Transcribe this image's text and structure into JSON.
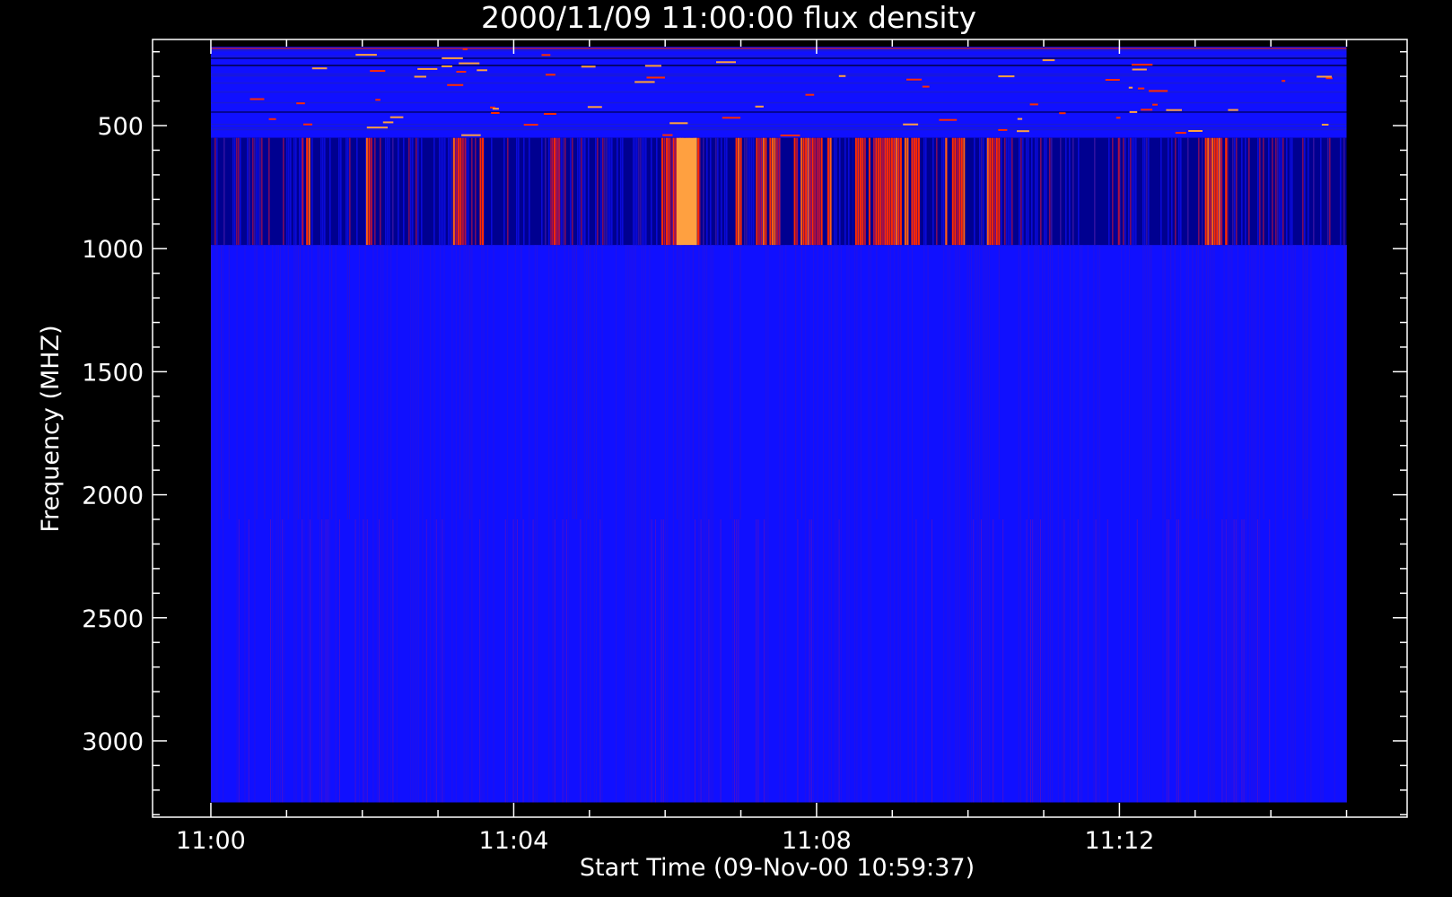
{
  "chart_data": {
    "type": "heatmap",
    "title": "2000/11/09 11:00:00 flux density",
    "xlabel": "Start Time (09-Nov-00 10:59:37)",
    "ylabel": "Frequency (MHZ)",
    "x_axis": {
      "ticks": [
        {
          "value": "11:00",
          "minutes": 0
        },
        {
          "value": "11:04",
          "minutes": 4
        },
        {
          "value": "11:08",
          "minutes": 8
        },
        {
          "value": "11:12",
          "minutes": 12
        }
      ],
      "minor_step_minutes": 1,
      "range_minutes": [
        -0.77,
        15.8
      ]
    },
    "y_axis": {
      "ticks": [
        500,
        1000,
        1500,
        2000,
        2500,
        3000
      ],
      "minor_step": 100,
      "range": [
        150,
        3310
      ],
      "inverted": true
    },
    "data_extent": {
      "time_minutes": [
        0,
        15
      ],
      "frequency": [
        180,
        3250
      ]
    },
    "bands": [
      {
        "frequency": [
          180,
          550
        ],
        "level": "low, noisy with sparse narrow spikes"
      },
      {
        "frequency": [
          550,
          985
        ],
        "level": "bursts (dark blue background with red/orange vertical bursts)"
      },
      {
        "frequency": [
          985,
          3250
        ],
        "level": "low (blue)"
      }
    ],
    "bursts_minutes": [
      [
        1.2,
        1.3
      ],
      [
        2.05,
        2.12
      ],
      [
        3.2,
        3.35
      ],
      [
        3.55,
        3.62
      ],
      [
        4.5,
        4.6
      ],
      [
        5.95,
        6.05
      ],
      [
        6.1,
        6.45
      ],
      [
        6.9,
        7.0
      ],
      [
        7.2,
        7.55
      ],
      [
        7.7,
        8.2
      ],
      [
        8.45,
        9.35
      ],
      [
        9.7,
        9.95
      ],
      [
        10.25,
        10.4
      ],
      [
        11.95,
        12.0
      ],
      [
        13.1,
        13.4
      ]
    ],
    "colors": {
      "background": "#000000",
      "low": "#1010ff",
      "dark_low": "#000090",
      "medium": "#b01040",
      "high": "#ff2a00",
      "peak": "#ffa040",
      "axis": "#ffffff"
    }
  }
}
